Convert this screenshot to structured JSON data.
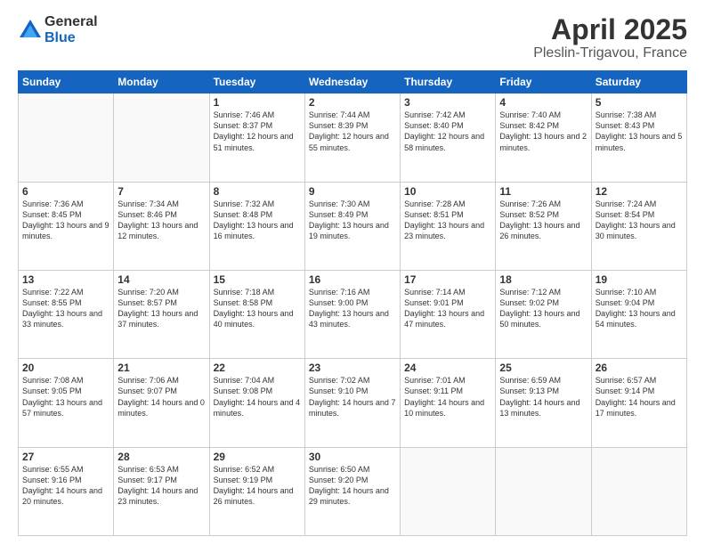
{
  "header": {
    "logo_line1": "General",
    "logo_line2": "Blue",
    "title": "April 2025",
    "subtitle": "Pleslin-Trigavou, France"
  },
  "days_of_week": [
    "Sunday",
    "Monday",
    "Tuesday",
    "Wednesday",
    "Thursday",
    "Friday",
    "Saturday"
  ],
  "weeks": [
    [
      {
        "day": "",
        "info": ""
      },
      {
        "day": "",
        "info": ""
      },
      {
        "day": "1",
        "info": "Sunrise: 7:46 AM\nSunset: 8:37 PM\nDaylight: 12 hours and 51 minutes."
      },
      {
        "day": "2",
        "info": "Sunrise: 7:44 AM\nSunset: 8:39 PM\nDaylight: 12 hours and 55 minutes."
      },
      {
        "day": "3",
        "info": "Sunrise: 7:42 AM\nSunset: 8:40 PM\nDaylight: 12 hours and 58 minutes."
      },
      {
        "day": "4",
        "info": "Sunrise: 7:40 AM\nSunset: 8:42 PM\nDaylight: 13 hours and 2 minutes."
      },
      {
        "day": "5",
        "info": "Sunrise: 7:38 AM\nSunset: 8:43 PM\nDaylight: 13 hours and 5 minutes."
      }
    ],
    [
      {
        "day": "6",
        "info": "Sunrise: 7:36 AM\nSunset: 8:45 PM\nDaylight: 13 hours and 9 minutes."
      },
      {
        "day": "7",
        "info": "Sunrise: 7:34 AM\nSunset: 8:46 PM\nDaylight: 13 hours and 12 minutes."
      },
      {
        "day": "8",
        "info": "Sunrise: 7:32 AM\nSunset: 8:48 PM\nDaylight: 13 hours and 16 minutes."
      },
      {
        "day": "9",
        "info": "Sunrise: 7:30 AM\nSunset: 8:49 PM\nDaylight: 13 hours and 19 minutes."
      },
      {
        "day": "10",
        "info": "Sunrise: 7:28 AM\nSunset: 8:51 PM\nDaylight: 13 hours and 23 minutes."
      },
      {
        "day": "11",
        "info": "Sunrise: 7:26 AM\nSunset: 8:52 PM\nDaylight: 13 hours and 26 minutes."
      },
      {
        "day": "12",
        "info": "Sunrise: 7:24 AM\nSunset: 8:54 PM\nDaylight: 13 hours and 30 minutes."
      }
    ],
    [
      {
        "day": "13",
        "info": "Sunrise: 7:22 AM\nSunset: 8:55 PM\nDaylight: 13 hours and 33 minutes."
      },
      {
        "day": "14",
        "info": "Sunrise: 7:20 AM\nSunset: 8:57 PM\nDaylight: 13 hours and 37 minutes."
      },
      {
        "day": "15",
        "info": "Sunrise: 7:18 AM\nSunset: 8:58 PM\nDaylight: 13 hours and 40 minutes."
      },
      {
        "day": "16",
        "info": "Sunrise: 7:16 AM\nSunset: 9:00 PM\nDaylight: 13 hours and 43 minutes."
      },
      {
        "day": "17",
        "info": "Sunrise: 7:14 AM\nSunset: 9:01 PM\nDaylight: 13 hours and 47 minutes."
      },
      {
        "day": "18",
        "info": "Sunrise: 7:12 AM\nSunset: 9:02 PM\nDaylight: 13 hours and 50 minutes."
      },
      {
        "day": "19",
        "info": "Sunrise: 7:10 AM\nSunset: 9:04 PM\nDaylight: 13 hours and 54 minutes."
      }
    ],
    [
      {
        "day": "20",
        "info": "Sunrise: 7:08 AM\nSunset: 9:05 PM\nDaylight: 13 hours and 57 minutes."
      },
      {
        "day": "21",
        "info": "Sunrise: 7:06 AM\nSunset: 9:07 PM\nDaylight: 14 hours and 0 minutes."
      },
      {
        "day": "22",
        "info": "Sunrise: 7:04 AM\nSunset: 9:08 PM\nDaylight: 14 hours and 4 minutes."
      },
      {
        "day": "23",
        "info": "Sunrise: 7:02 AM\nSunset: 9:10 PM\nDaylight: 14 hours and 7 minutes."
      },
      {
        "day": "24",
        "info": "Sunrise: 7:01 AM\nSunset: 9:11 PM\nDaylight: 14 hours and 10 minutes."
      },
      {
        "day": "25",
        "info": "Sunrise: 6:59 AM\nSunset: 9:13 PM\nDaylight: 14 hours and 13 minutes."
      },
      {
        "day": "26",
        "info": "Sunrise: 6:57 AM\nSunset: 9:14 PM\nDaylight: 14 hours and 17 minutes."
      }
    ],
    [
      {
        "day": "27",
        "info": "Sunrise: 6:55 AM\nSunset: 9:16 PM\nDaylight: 14 hours and 20 minutes."
      },
      {
        "day": "28",
        "info": "Sunrise: 6:53 AM\nSunset: 9:17 PM\nDaylight: 14 hours and 23 minutes."
      },
      {
        "day": "29",
        "info": "Sunrise: 6:52 AM\nSunset: 9:19 PM\nDaylight: 14 hours and 26 minutes."
      },
      {
        "day": "30",
        "info": "Sunrise: 6:50 AM\nSunset: 9:20 PM\nDaylight: 14 hours and 29 minutes."
      },
      {
        "day": "",
        "info": ""
      },
      {
        "day": "",
        "info": ""
      },
      {
        "day": "",
        "info": ""
      }
    ]
  ]
}
